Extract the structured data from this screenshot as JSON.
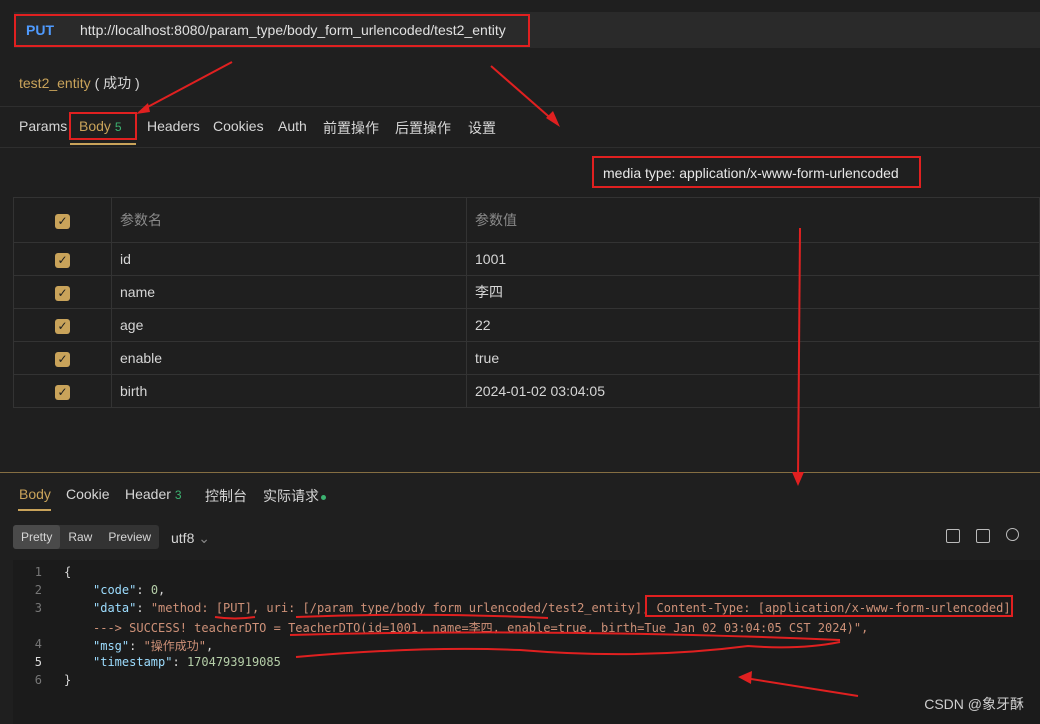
{
  "request": {
    "method": "PUT",
    "url": "http://localhost:8080/param_type/body_form_urlencoded/test2_entity",
    "name": "test2_entity",
    "status": "( 成功 )"
  },
  "request_tabs": [
    {
      "label": "Params"
    },
    {
      "label": "Body",
      "badge": "5"
    },
    {
      "label": "Headers"
    },
    {
      "label": "Cookies"
    },
    {
      "label": "Auth"
    },
    {
      "label": "前置操作"
    },
    {
      "label": "后置操作"
    },
    {
      "label": "设置"
    }
  ],
  "media_type": "media type: application/x-www-form-urlencoded",
  "params_table": {
    "headers": [
      "参数名",
      "参数值"
    ],
    "rows": [
      {
        "name": "id",
        "value": "1001"
      },
      {
        "name": "name",
        "value": "李四"
      },
      {
        "name": "age",
        "value": "22"
      },
      {
        "name": "enable",
        "value": "true"
      },
      {
        "name": "birth",
        "value": "2024-01-02 03:04:05"
      }
    ]
  },
  "response_tabs": [
    {
      "label": "Body"
    },
    {
      "label": "Cookie"
    },
    {
      "label": "Header",
      "badge": "3"
    },
    {
      "label": "控制台"
    },
    {
      "label": "实际请求"
    }
  ],
  "view_modes": [
    "Pretty",
    "Raw",
    "Preview"
  ],
  "encoding": "utf8",
  "code": {
    "line_numbers": [
      "1",
      "2",
      "3",
      "4",
      "5",
      "6"
    ],
    "l1": "{",
    "code_key": "\"code\"",
    "code_val": "0",
    "data_key": "\"data\"",
    "data_val_a": "\"method: [PUT], uri: [/param_type/body_form_urlencoded/test2_entity], ",
    "data_val_b": "Content-Type: [application/x-www-form-urlencoded]",
    "data_val_c": "---> SUCCESS! teacherDTO = TeacherDTO(id=1001, name=李四, enable=true, birth=Tue Jan 02 03:04:05 CST 2024)\",",
    "msg_key": "\"msg\"",
    "msg_val": "\"操作成功\"",
    "ts_key": "\"timestamp\"",
    "ts_val": "1704793919085",
    "l6": "}"
  },
  "watermark": "CSDN @象牙酥"
}
